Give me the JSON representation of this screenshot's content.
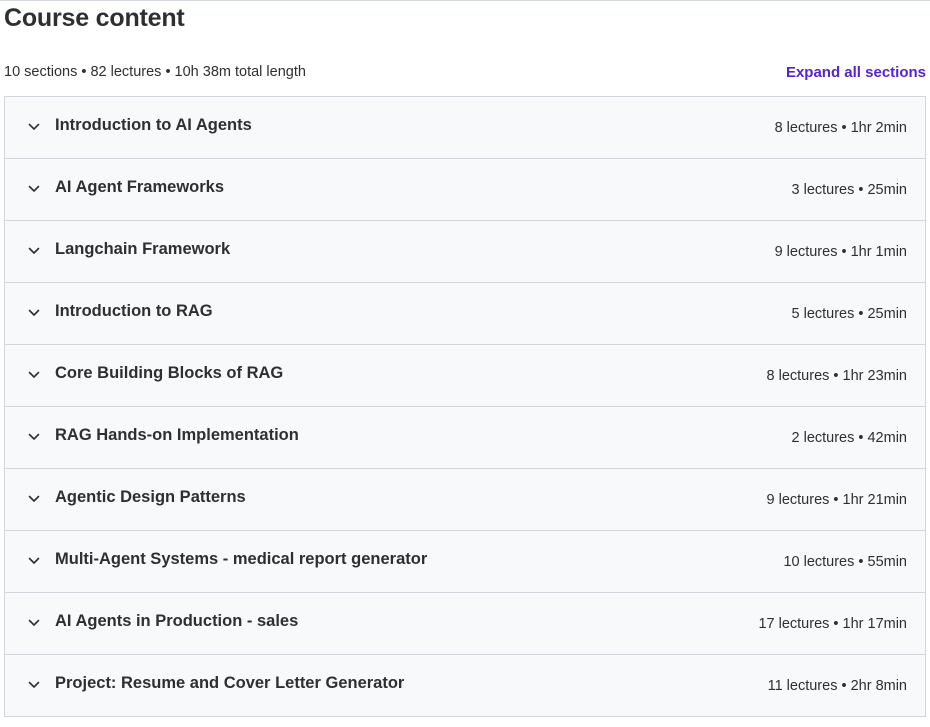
{
  "header": {
    "title": "Course content"
  },
  "summary": {
    "text": "10 sections • 82 lectures • 10h 38m total length",
    "expand_label": "Expand all sections"
  },
  "colors": {
    "accent": "#5624d0",
    "row_bg": "#f7f9fa",
    "border": "#d1d7dc",
    "text": "#2d2f31"
  },
  "icons": {
    "row_toggle": "chevron-down-icon"
  },
  "sections": [
    {
      "title": "Introduction to AI Agents",
      "meta": "8 lectures • 1hr 2min"
    },
    {
      "title": "AI Agent Frameworks",
      "meta": "3 lectures • 25min"
    },
    {
      "title": "Langchain Framework",
      "meta": "9 lectures • 1hr 1min"
    },
    {
      "title": "Introduction to RAG",
      "meta": "5 lectures • 25min"
    },
    {
      "title": "Core Building Blocks of RAG",
      "meta": "8 lectures • 1hr 23min"
    },
    {
      "title": "RAG Hands-on Implementation",
      "meta": "2 lectures • 42min"
    },
    {
      "title": "Agentic Design Patterns",
      "meta": "9 lectures • 1hr 21min"
    },
    {
      "title": "Multi-Agent Systems - medical report generator",
      "meta": "10 lectures • 55min"
    },
    {
      "title": "AI Agents in Production - sales",
      "meta": "17 lectures • 1hr 17min"
    },
    {
      "title": "Project: Resume and Cover Letter Generator",
      "meta": "11 lectures • 2hr 8min"
    }
  ]
}
